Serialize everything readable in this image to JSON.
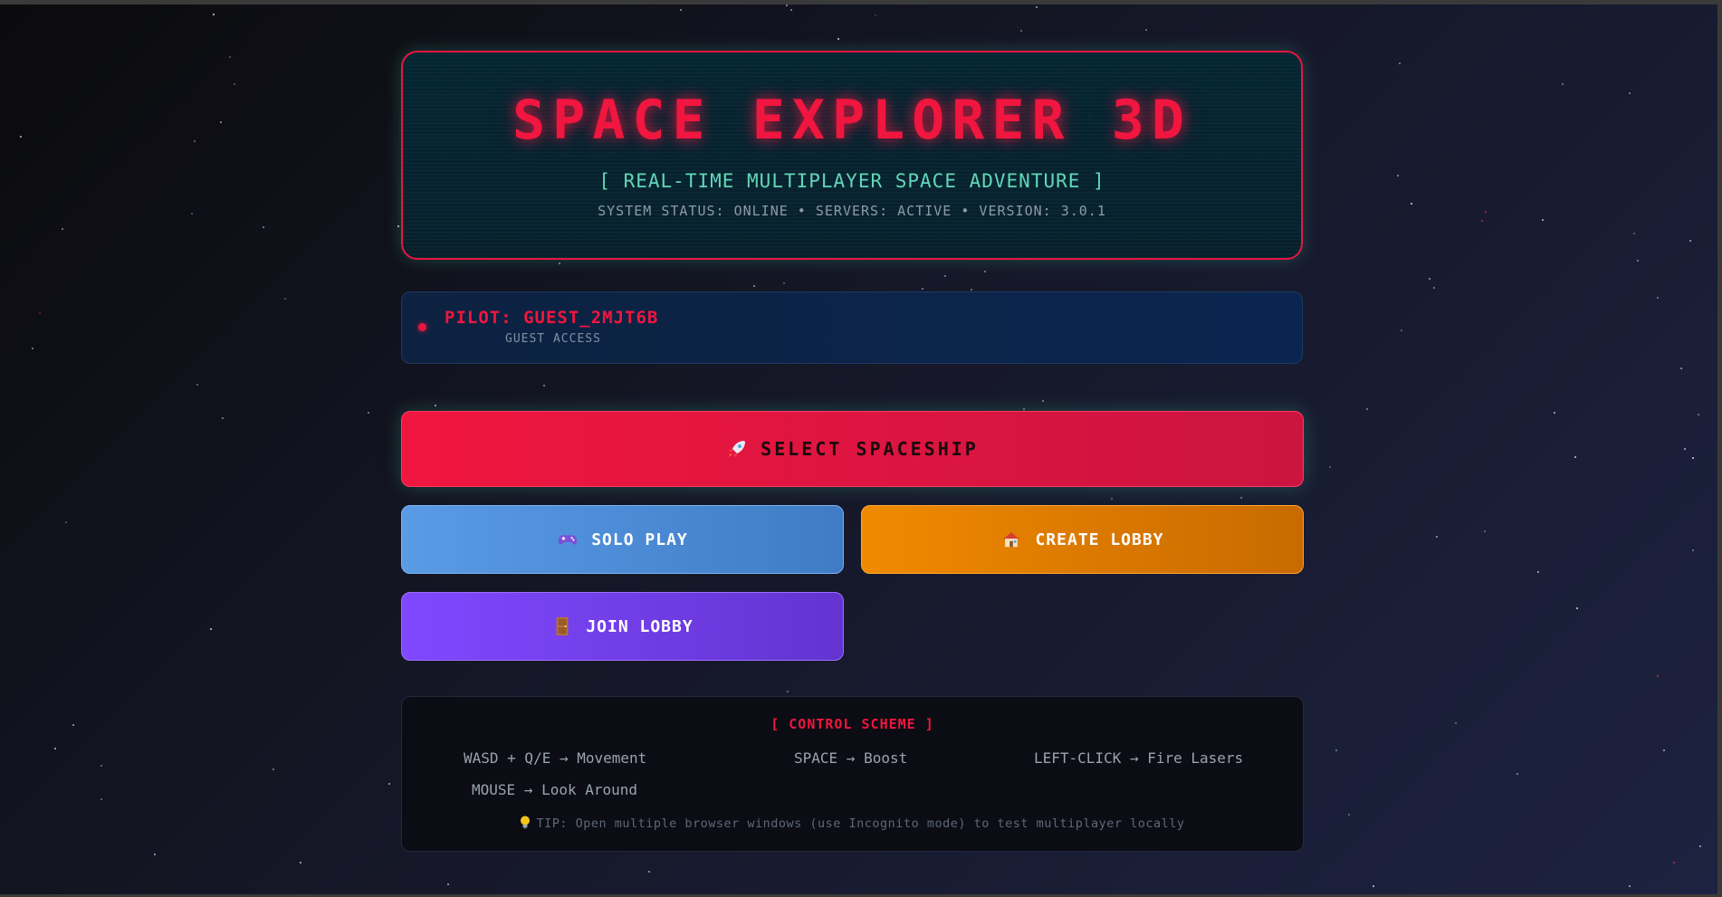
{
  "header": {
    "title": "SPACE EXPLORER 3D",
    "subtitle": "[ REAL-TIME MULTIPLAYER SPACE ADVENTURE ]",
    "status_line": "SYSTEM STATUS: ONLINE • SERVERS: ACTIVE • VERSION: 3.0.1"
  },
  "pilot": {
    "name": "PILOT: GUEST_2MJT6B",
    "access": "GUEST ACCESS"
  },
  "buttons": {
    "select_spaceship": {
      "label": "SELECT SPACESHIP",
      "icon": "rocket-icon"
    },
    "solo_play": {
      "label": "SOLO PLAY",
      "icon": "gamepad-icon"
    },
    "create_lobby": {
      "label": "CREATE LOBBY",
      "icon": "house-icon"
    },
    "join_lobby": {
      "label": "JOIN LOBBY",
      "icon": "door-icon"
    }
  },
  "controls": {
    "title": "[ CONTROL SCHEME ]",
    "items": [
      "WASD + Q/E → Movement",
      "SPACE → Boost",
      "LEFT-CLICK → Fire Lasers",
      "MOUSE → Look Around"
    ],
    "tip": "TIP: Open multiple browser windows (use Incognito mode) to test multiplayer locally",
    "tip_icon": "lightbulb-icon"
  },
  "colors": {
    "accent_red": "#f0163f",
    "accent_teal": "#63d6b8",
    "solo_blue": "#5a9be6",
    "create_orange": "#f08a00",
    "join_purple": "#8048ff"
  }
}
